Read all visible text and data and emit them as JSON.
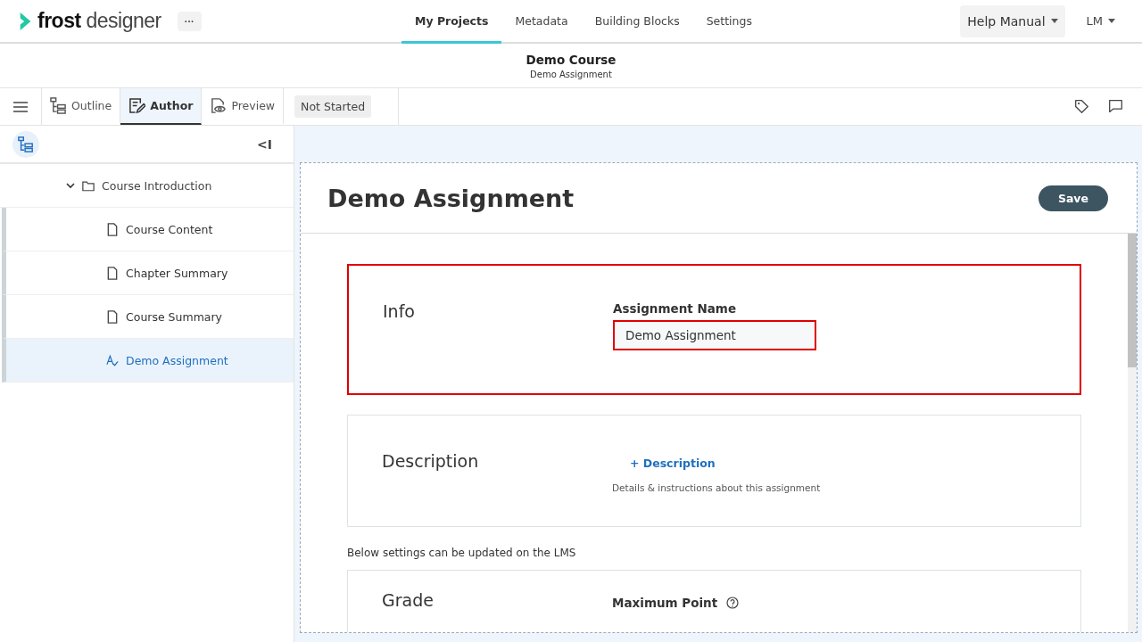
{
  "logo": "**frost** designer",
  "more_button": "···",
  "nav": [
    {
      "label": "My Projects",
      "selected": true
    },
    {
      "label": "Metadata",
      "selected": false
    },
    {
      "label": "Building Blocks",
      "selected": false
    },
    {
      "label": "Settings",
      "selected": false
    }
  ],
  "help_menu": "Help Manual",
  "user_menu": "LM",
  "header": {
    "title": "Demo Course",
    "subtitle": "Demo Assignment"
  },
  "view_tabs": [
    {
      "label": "Outline",
      "selected": false
    },
    {
      "label": "Author",
      "selected": true
    },
    {
      "label": "Preview",
      "selected": false
    }
  ],
  "status": "Not Started",
  "collapse_button": "<I",
  "tree": [
    {
      "label": "Course Introduction",
      "kind": "folder",
      "expanded": true,
      "selected": false,
      "children": [
        {
          "label": "Course Content",
          "kind": "page",
          "selected": false
        },
        {
          "label": "Chapter Summary",
          "kind": "page",
          "selected": false
        },
        {
          "label": "Course Summary",
          "kind": "page",
          "selected": false
        },
        {
          "label": "Demo Assignment",
          "kind": "assignment",
          "selected": true
        }
      ]
    }
  ],
  "editor": {
    "title": "Demo Assignment",
    "save_button": "Save",
    "sections": [
      {
        "kind": "info",
        "title": "Info",
        "highlighted": true,
        "field_label": "Assignment Name",
        "field_value": "Demo Assignment",
        "field_highlighted": true
      },
      {
        "kind": "description",
        "title": "Description",
        "add_link": "+ Description",
        "hint": "Details & instructions about this assignment",
        "highlighted": false
      },
      {
        "kind": "note",
        "text": "Below settings can be updated on the LMS"
      },
      {
        "kind": "grade",
        "title": "Grade",
        "field_label": "Maximum Point",
        "highlighted": false
      }
    ]
  }
}
